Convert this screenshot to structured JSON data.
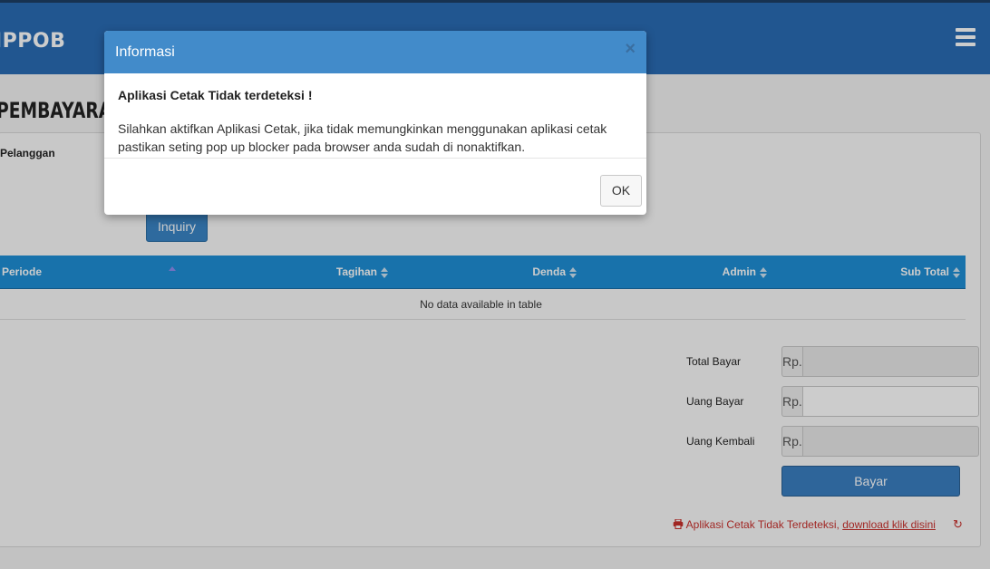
{
  "app": {
    "brand": "IPPOB"
  },
  "page": {
    "heading": "PEMBAYARAN L",
    "field_label": "Pelanggan",
    "inquiry_label": "Inquiry"
  },
  "table": {
    "columns": [
      "Periode",
      "Tagihan",
      "Denda",
      "Admin",
      "Sub Total"
    ],
    "empty_message": "No data available in table"
  },
  "payment": {
    "currency_prefix": "Rp.",
    "total_label": "Total Bayar",
    "paid_label": "Uang Bayar",
    "change_label": "Uang Kembali",
    "total_value": "",
    "paid_value": "",
    "change_value": "",
    "pay_button": "Bayar"
  },
  "printer_notice": {
    "text": "Aplikasi Cetak Tidak Terdeteksi,",
    "link": "download klik disini"
  },
  "modal": {
    "title": "Informasi",
    "close_symbol": "×",
    "heading": "Aplikasi Cetak Tidak terdeteksi !",
    "message_line1": "Silahkan aktifkan Aplikasi Cetak, jika tidak memungkinkan menggunakan aplikasi cetak",
    "message_line2": "pastikan seting pop up blocker pada browser anda sudah di nonaktifkan.",
    "ok_label": "OK"
  },
  "colors": {
    "header_bg": "#2a6cb5",
    "table_header": "#1f8fd6",
    "modal_header": "#428bca",
    "warning_red": "#c9302c"
  },
  "icons": [
    "hamburger-menu-icon",
    "sort-icon",
    "printer-icon",
    "refresh-icon",
    "close-icon"
  ]
}
